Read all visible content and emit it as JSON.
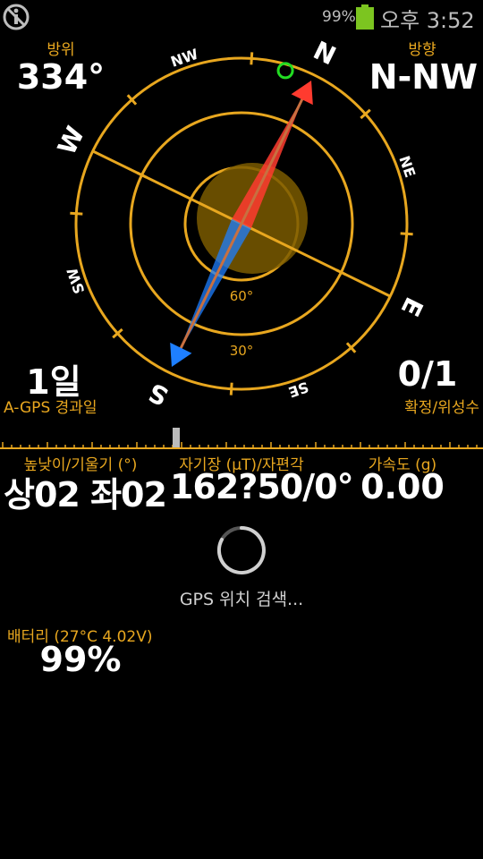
{
  "status_bar": {
    "battery_percent": "99%",
    "time": "오후 3:52",
    "battery_color": "#7cc520"
  },
  "compass": {
    "bearing_label": "방위",
    "bearing_value": "334°",
    "direction_label": "방향",
    "direction_value": "N-NW",
    "cardinals": {
      "n": "N",
      "s": "S",
      "e": "E",
      "w": "W",
      "ne": "NE",
      "nw": "NW",
      "se": "SE",
      "sw": "SW"
    },
    "ring_labels": {
      "inner": "60°",
      "middle": "30°"
    },
    "heading_deg": 334,
    "ring_color": "#e8a71f",
    "north_color": "#ff3b2f",
    "south_color": "#1e7fff"
  },
  "gps": {
    "agps_value": "1일",
    "agps_label": "A-GPS 경과일",
    "fix_value": "0/1",
    "fix_label": "확정/위성수",
    "searching_text": "GPS 위치 검색..."
  },
  "sensors": {
    "pitch_label": "높낮이/기울기 (°)",
    "pitch_value": "상02 좌02",
    "magnetic_label": "자기장 (µT)/자편각",
    "magnetic_value": "162?50/0°",
    "accel_label": "가속도 (g)",
    "accel_value": "0.00"
  },
  "battery": {
    "label": "배터리 (27°C 4.02V)",
    "value": "99%"
  }
}
